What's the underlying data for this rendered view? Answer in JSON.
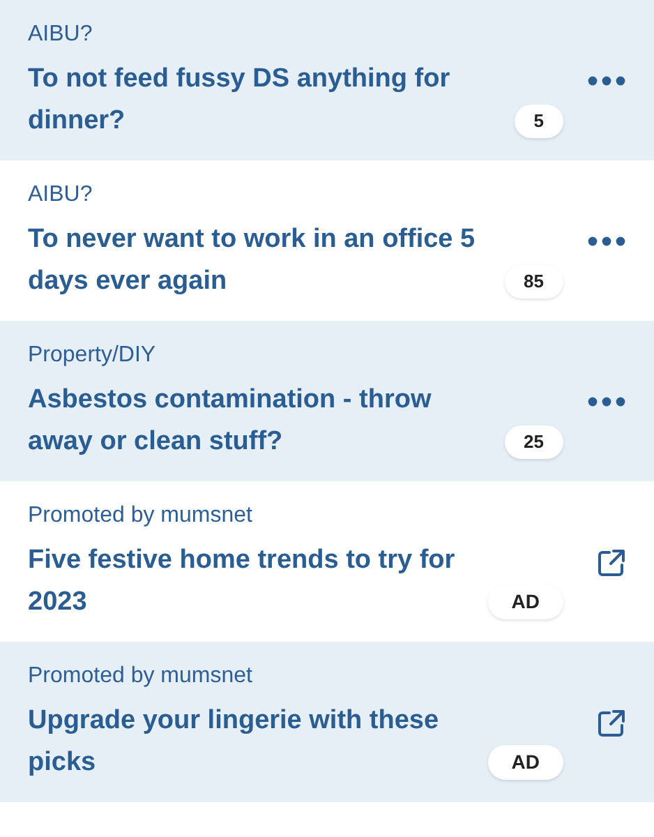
{
  "threads": [
    {
      "kind": "thread",
      "category": "AIBU?",
      "title": "To not feed fussy DS anything for dinner?",
      "count": "5"
    },
    {
      "kind": "thread",
      "category": "AIBU?",
      "title": "To never want to work in an office 5 days ever again",
      "count": "85"
    },
    {
      "kind": "thread",
      "category": "Property/DIY",
      "title": "Asbestos contamination - throw away or clean stuff?",
      "count": "25"
    },
    {
      "kind": "ad",
      "category": "Promoted by mumsnet",
      "title": "Five festive home trends to try for 2023",
      "badge": "AD"
    },
    {
      "kind": "ad",
      "category": "Promoted by mumsnet",
      "title": "Upgrade your lingerie with these picks",
      "badge": "AD"
    }
  ]
}
